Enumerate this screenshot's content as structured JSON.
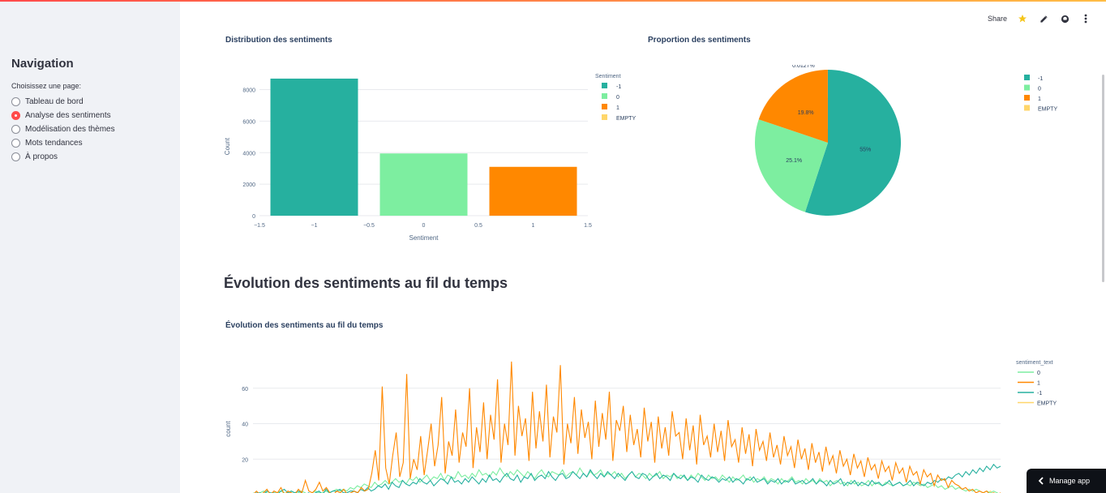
{
  "sidebar": {
    "title": "Navigation",
    "prompt": "Choisissez une page:",
    "items": [
      {
        "label": "Tableau de bord",
        "selected": false
      },
      {
        "label": "Analyse des sentiments",
        "selected": true
      },
      {
        "label": "Modélisation des thèmes",
        "selected": false
      },
      {
        "label": "Mots tendances",
        "selected": false
      },
      {
        "label": "À propos",
        "selected": false
      }
    ]
  },
  "toolbar": {
    "share_label": "Share",
    "icons": [
      "star-icon",
      "edit-icon",
      "github-icon",
      "more-vert-icon"
    ]
  },
  "section_heading": "Évolution des sentiments au fil du temps",
  "manage_app_label": "Manage app",
  "colors": {
    "neg": "#26b09f",
    "neu": "#7deea0",
    "pos": "#ff8800",
    "empty": "#ffd66a",
    "accent": "#ff4b4b"
  },
  "chart_data": [
    {
      "type": "bar",
      "title": "Distribution des sentiments",
      "xlabel": "Sentiment",
      "ylabel": "Count",
      "x_ticks": [
        "−1.5",
        "−1",
        "−0.5",
        "0",
        "0.5",
        "1",
        "1.5"
      ],
      "y_ticks": [
        "0",
        "2000",
        "4000",
        "6000",
        "8000"
      ],
      "xlim": [
        -1.5,
        1.5
      ],
      "ylim": [
        0,
        8800
      ],
      "legend_title": "Sentiment",
      "legend": [
        "-1",
        "0",
        "1",
        "EMPTY"
      ],
      "categories": [
        -1,
        0,
        1
      ],
      "values": [
        8700,
        3950,
        3100
      ]
    },
    {
      "type": "pie",
      "title": "Proportion des sentiments",
      "legend": [
        "-1",
        "0",
        "1",
        "EMPTY"
      ],
      "slices": [
        {
          "label": "-1",
          "value": 55,
          "text": "55%"
        },
        {
          "label": "0",
          "value": 25.1,
          "text": "25.1%"
        },
        {
          "label": "1",
          "value": 19.8,
          "text": "19.8%"
        },
        {
          "label": "EMPTY",
          "value": 0.0127,
          "text": "0.0127%"
        }
      ]
    },
    {
      "type": "line",
      "title": "Évolution des sentiments au fil du temps",
      "ylabel": "count",
      "y_ticks": [
        "20",
        "40",
        "60"
      ],
      "legend_title": "sentiment_text",
      "legend": [
        "0",
        "1",
        "-1",
        "EMPTY"
      ],
      "series": [
        {
          "name": "-1",
          "values": [
            0,
            1,
            1,
            0,
            2,
            1,
            1,
            0,
            2,
            3,
            1,
            2,
            1,
            2,
            1,
            0,
            1,
            0,
            1,
            2,
            0,
            3,
            1,
            2,
            2,
            3,
            1,
            1,
            2,
            2,
            1,
            3,
            2,
            4,
            2,
            3,
            5,
            4,
            6,
            3,
            7,
            5,
            4,
            8,
            6,
            5,
            7,
            6,
            9,
            7,
            6,
            8,
            5,
            7,
            9,
            8,
            6,
            10,
            7,
            8,
            6,
            9,
            7,
            10,
            8,
            6,
            9,
            7,
            11,
            8,
            9,
            7,
            10,
            12,
            9,
            8,
            11,
            7,
            10,
            9,
            12,
            8,
            10,
            11,
            9,
            13,
            10,
            8,
            11,
            12,
            9,
            10,
            13,
            11,
            9,
            12,
            10,
            14,
            11,
            9,
            12,
            10,
            13,
            11,
            9,
            12,
            10,
            8,
            11,
            13,
            10,
            9,
            12,
            11,
            8,
            10,
            12,
            9,
            11,
            10,
            8,
            12,
            10,
            9,
            11,
            8,
            10,
            9,
            7,
            11,
            9,
            8,
            10,
            9,
            7,
            9,
            8,
            10,
            7,
            9,
            8,
            6,
            9,
            8,
            10,
            7,
            8,
            9,
            6,
            8,
            7,
            9,
            6,
            8,
            7,
            9,
            6,
            7,
            8,
            6,
            7,
            9,
            6,
            8,
            7,
            5,
            8,
            6,
            7,
            9,
            5,
            7,
            6,
            8,
            5,
            7,
            6,
            5,
            8,
            6,
            7,
            5,
            6,
            8,
            5,
            6,
            7,
            5,
            6,
            8,
            5,
            7,
            6,
            5,
            7,
            6,
            8,
            7,
            9,
            8,
            10,
            9,
            11,
            12,
            10,
            13,
            11,
            14,
            12,
            15,
            13,
            16,
            14,
            17,
            15,
            16
          ]
        },
        {
          "name": "0",
          "values": [
            1,
            0,
            1,
            2,
            1,
            0,
            1,
            1,
            2,
            1,
            0,
            2,
            1,
            1,
            2,
            1,
            0,
            1,
            2,
            1,
            1,
            2,
            1,
            2,
            3,
            2,
            3,
            2,
            4,
            3,
            5,
            4,
            6,
            5,
            4,
            7,
            5,
            6,
            8,
            6,
            7,
            9,
            7,
            8,
            6,
            9,
            8,
            10,
            7,
            9,
            11,
            8,
            10,
            9,
            12,
            8,
            11,
            10,
            9,
            13,
            10,
            11,
            9,
            12,
            10,
            14,
            11,
            12,
            10,
            13,
            11,
            15,
            12,
            10,
            13,
            11,
            14,
            12,
            10,
            13,
            11,
            9,
            12,
            14,
            11,
            10,
            13,
            12,
            11,
            14,
            10,
            12,
            13,
            11,
            15,
            12,
            10,
            13,
            11,
            12,
            14,
            10,
            12,
            11,
            13,
            10,
            12,
            9,
            11,
            13,
            10,
            12,
            11,
            9,
            12,
            10,
            11,
            13,
            9,
            11,
            10,
            12,
            9,
            11,
            10,
            8,
            11,
            9,
            12,
            10,
            8,
            11,
            9,
            10,
            8,
            11,
            9,
            7,
            10,
            8,
            9,
            11,
            8,
            10,
            7,
            9,
            8,
            10,
            7,
            9,
            8,
            6,
            9,
            7,
            8,
            10,
            7,
            8,
            6,
            9,
            7,
            8,
            6,
            9,
            7,
            8,
            5,
            7,
            8,
            6,
            7,
            5,
            8,
            6,
            7,
            5,
            6,
            8,
            5,
            7,
            6,
            5,
            7,
            6,
            5,
            6,
            7,
            5,
            6,
            5,
            7,
            6,
            5,
            6,
            4,
            5,
            6,
            4,
            5,
            3,
            4,
            5,
            3,
            4,
            3,
            2,
            3,
            2,
            3,
            2,
            1,
            2,
            1,
            2,
            1,
            0
          ]
        },
        {
          "name": "1",
          "values": [
            0,
            2,
            0,
            1,
            3,
            0,
            2,
            1,
            4,
            0,
            2,
            1,
            0,
            3,
            1,
            8,
            2,
            1,
            3,
            7,
            2,
            4,
            1,
            0,
            2,
            1,
            3,
            0,
            1,
            2,
            1,
            4,
            2,
            3,
            12,
            25,
            8,
            61,
            15,
            6,
            22,
            35,
            10,
            18,
            68,
            9,
            20,
            14,
            33,
            11,
            25,
            40,
            16,
            28,
            55,
            12,
            30,
            22,
            48,
            18,
            35,
            27,
            60,
            15,
            38,
            24,
            52,
            20,
            45,
            31,
            65,
            18,
            40,
            28,
            75,
            22,
            50,
            33,
            43,
            19,
            58,
            26,
            47,
            30,
            62,
            21,
            44,
            35,
            73,
            17,
            40,
            29,
            55,
            23,
            48,
            32,
            41,
            20,
            53,
            27,
            46,
            31,
            58,
            19,
            42,
            36,
            50,
            24,
            45,
            28,
            37,
            21,
            49,
            30,
            41,
            18,
            44,
            26,
            38,
            22,
            47,
            33,
            35,
            20,
            43,
            25,
            39,
            17,
            45,
            28,
            33,
            21,
            40,
            24,
            36,
            19,
            42,
            27,
            31,
            18,
            38,
            23,
            34,
            16,
            37,
            25,
            30,
            19,
            35,
            21,
            28,
            17,
            33,
            22,
            27,
            15,
            31,
            20,
            26,
            14,
            29,
            18,
            24,
            13,
            27,
            17,
            22,
            12,
            25,
            16,
            20,
            11,
            23,
            15,
            19,
            10,
            21,
            14,
            17,
            9,
            19,
            13,
            16,
            8,
            18,
            12,
            15,
            7,
            16,
            11,
            13,
            6,
            14,
            10,
            12,
            5,
            11,
            8,
            9,
            4,
            8,
            6,
            5,
            3,
            4,
            2,
            3,
            1,
            2,
            1,
            2,
            0,
            1,
            0,
            1
          ]
        },
        {
          "name": "EMPTY",
          "values": [
            0,
            0,
            0,
            0,
            0,
            0,
            0,
            0,
            0,
            0,
            0,
            0,
            0,
            0,
            0,
            0,
            0,
            0,
            0,
            0,
            0,
            0,
            0,
            0,
            0,
            0,
            0,
            0,
            0,
            0,
            0,
            0,
            0,
            0,
            0,
            0,
            0,
            0,
            0,
            0,
            0,
            0,
            0,
            0,
            0,
            0,
            0,
            0,
            0,
            0,
            0,
            0,
            0,
            0,
            0,
            0,
            0,
            0,
            0,
            0,
            0,
            0,
            0,
            0,
            0,
            0,
            0,
            0,
            0,
            0,
            0,
            0,
            0,
            0,
            0,
            0,
            0,
            0,
            0,
            0,
            0,
            0,
            0,
            0,
            0,
            0,
            0,
            0,
            0,
            0,
            0,
            0,
            0,
            0,
            0,
            0,
            0,
            0,
            0,
            0,
            0,
            0,
            0,
            0,
            0,
            0,
            0,
            0,
            0,
            0,
            0,
            0,
            0,
            0,
            0,
            0,
            0,
            0,
            0,
            0,
            0,
            0,
            0,
            0,
            0,
            0,
            0,
            0,
            0,
            0,
            0,
            0,
            0,
            0,
            0,
            0,
            0,
            0,
            0,
            0,
            0,
            0,
            0,
            0,
            0,
            0,
            0,
            0,
            0,
            0,
            0,
            0,
            0,
            0,
            0,
            0,
            0,
            0,
            0,
            0,
            0,
            0,
            0,
            0,
            0,
            0,
            0,
            0,
            0,
            0,
            0,
            0,
            0,
            0,
            0,
            0,
            0,
            0,
            0,
            0,
            0,
            0,
            0,
            0,
            0,
            0,
            0,
            0,
            0,
            0,
            0,
            0,
            0,
            0,
            0,
            0,
            0,
            0,
            0,
            0,
            0,
            0,
            0,
            0,
            0,
            0,
            0,
            0,
            0,
            0,
            0,
            0,
            0,
            0,
            0,
            0,
            2,
            0,
            1,
            0
          ]
        }
      ]
    }
  ]
}
